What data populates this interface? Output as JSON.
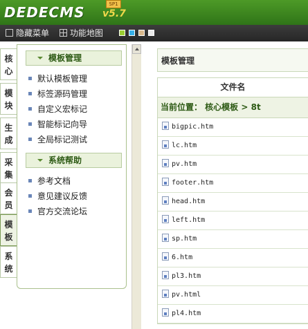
{
  "app": {
    "logo": "DEDECMS",
    "version": "v5.7",
    "badge": "SP1"
  },
  "toolbar": {
    "hide_menu": "隐藏菜单",
    "sitemap": "功能地图",
    "swatches": [
      "#9acd32",
      "#38b0e8",
      "#d8b88c",
      "#e8e8e8"
    ]
  },
  "vtabs": [
    [
      "核",
      "心"
    ],
    [
      "模",
      "块"
    ],
    [
      "生",
      "成"
    ],
    [
      "采",
      "集"
    ],
    [
      "会",
      "员"
    ],
    [
      "模",
      "板"
    ],
    [
      "系",
      "统"
    ]
  ],
  "menu": {
    "sections": [
      {
        "title": "模板管理",
        "items": [
          "默认模板管理",
          "标签源码管理",
          "自定义宏标记",
          "智能标记向导",
          "全局标记测试"
        ]
      },
      {
        "title": "系统帮助",
        "items": [
          "参考文档",
          "意见建议反馈",
          "官方交流论坛"
        ]
      }
    ]
  },
  "main": {
    "title": "模板管理",
    "column_header": "文件名",
    "location": "当前位置： 核心模板 > 8t",
    "files": [
      "bigpic.htm",
      "lc.htm",
      "pv.htm",
      "footer.htm",
      "head.htm",
      "left.htm",
      "sp.htm",
      "6.htm",
      "pl3.htm",
      "pv.html",
      "pl4.htm"
    ]
  }
}
